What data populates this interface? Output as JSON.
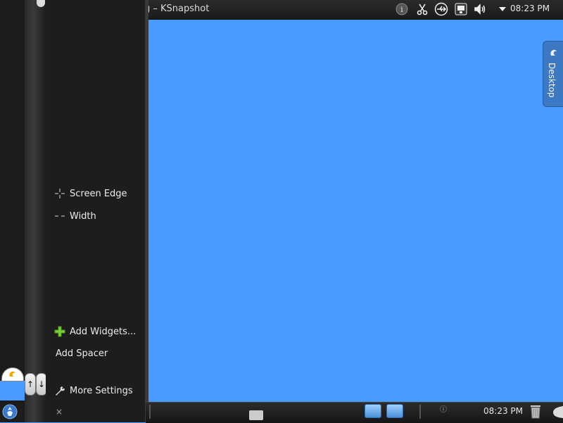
{
  "top_panel": {
    "title": "g – KSnapshot",
    "clock": "08:23 PM",
    "icons": [
      "info-icon",
      "scissors-icon",
      "usb-icon",
      "network-icon",
      "volume-icon",
      "tray-expand-icon"
    ]
  },
  "config_panel": {
    "items": {
      "screen_edge": "Screen Edge",
      "width": "Width",
      "add_widgets": "Add Widgets...",
      "add_spacer": "Add Spacer",
      "more_settings": "More Settings"
    },
    "close_symbol": "×"
  },
  "desktop_tab": {
    "label": "Desktop"
  },
  "bottom_panel": {
    "clock": "08:23 PM"
  },
  "colors": {
    "desktop": "#4a9bff",
    "panel": "#1d1d1d",
    "accent_green": "#7bcf3b",
    "tab_blue": "#3d78c2"
  }
}
